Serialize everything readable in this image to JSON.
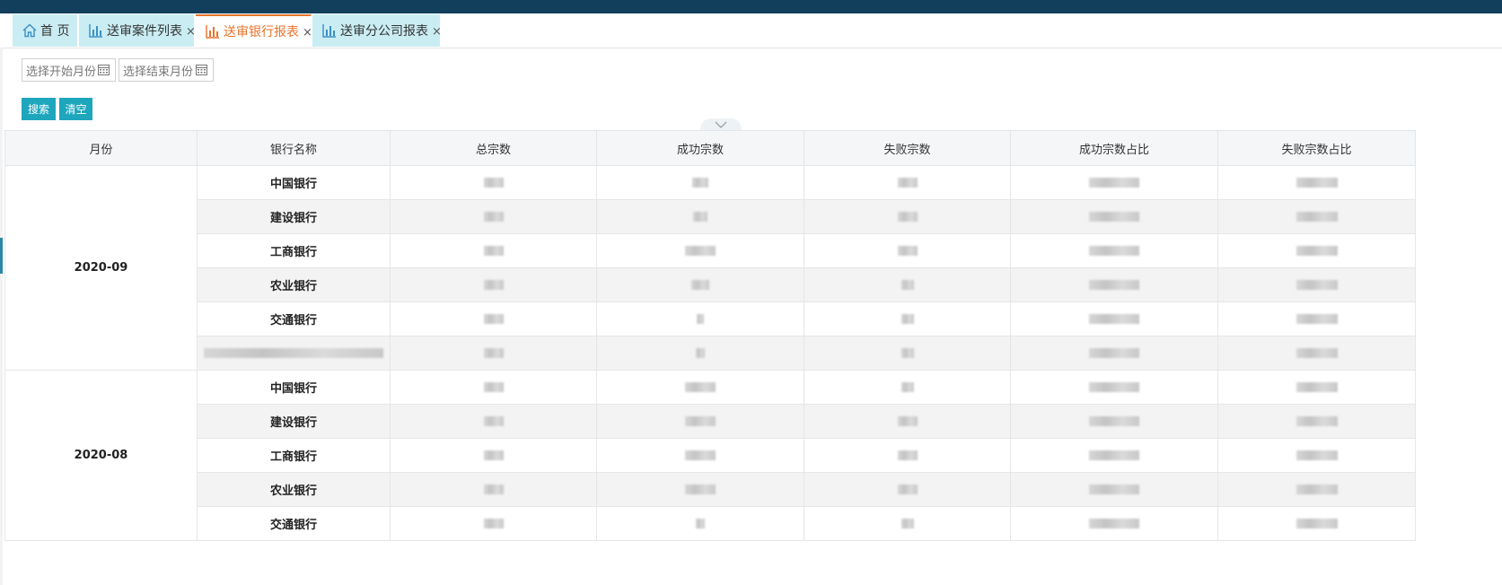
{
  "tabs": [
    {
      "label": "首 页",
      "icon": "home-icon",
      "closable": false
    },
    {
      "label": "送审案件列表",
      "icon": "bar-chart-icon",
      "closable": true
    },
    {
      "label": "送审银行报表",
      "icon": "bar-chart-icon",
      "closable": true,
      "active": true
    },
    {
      "label": "送审分公司报表",
      "icon": "bar-chart-icon",
      "closable": true
    }
  ],
  "tab_close_glyph": "×",
  "filters": {
    "start_month_placeholder": "选择开始月份",
    "end_month_placeholder": "选择结束月份"
  },
  "buttons": {
    "search": "搜索",
    "clear": "清空"
  },
  "table": {
    "headers": [
      "月份",
      "银行名称",
      "总宗数",
      "成功宗数",
      "失败宗数",
      "成功宗数占比",
      "失败宗数占比"
    ],
    "groups": [
      {
        "month": "2020-09",
        "rows": [
          {
            "bank": "中国银行"
          },
          {
            "bank": "建设银行"
          },
          {
            "bank": "工商银行"
          },
          {
            "bank": "农业银行"
          },
          {
            "bank": "交通银行"
          },
          {
            "bank": ""
          }
        ]
      },
      {
        "month": "2020-08",
        "rows": [
          {
            "bank": "中国银行"
          },
          {
            "bank": "建设银行"
          },
          {
            "bank": "工商银行"
          },
          {
            "bank": "农业银行"
          },
          {
            "bank": "交通银行"
          }
        ]
      }
    ]
  },
  "colors": {
    "topbar": "#123f5b",
    "tab_bg": "#c9edf3",
    "tab_active": "#e8732a",
    "button": "#1ea6bd"
  }
}
